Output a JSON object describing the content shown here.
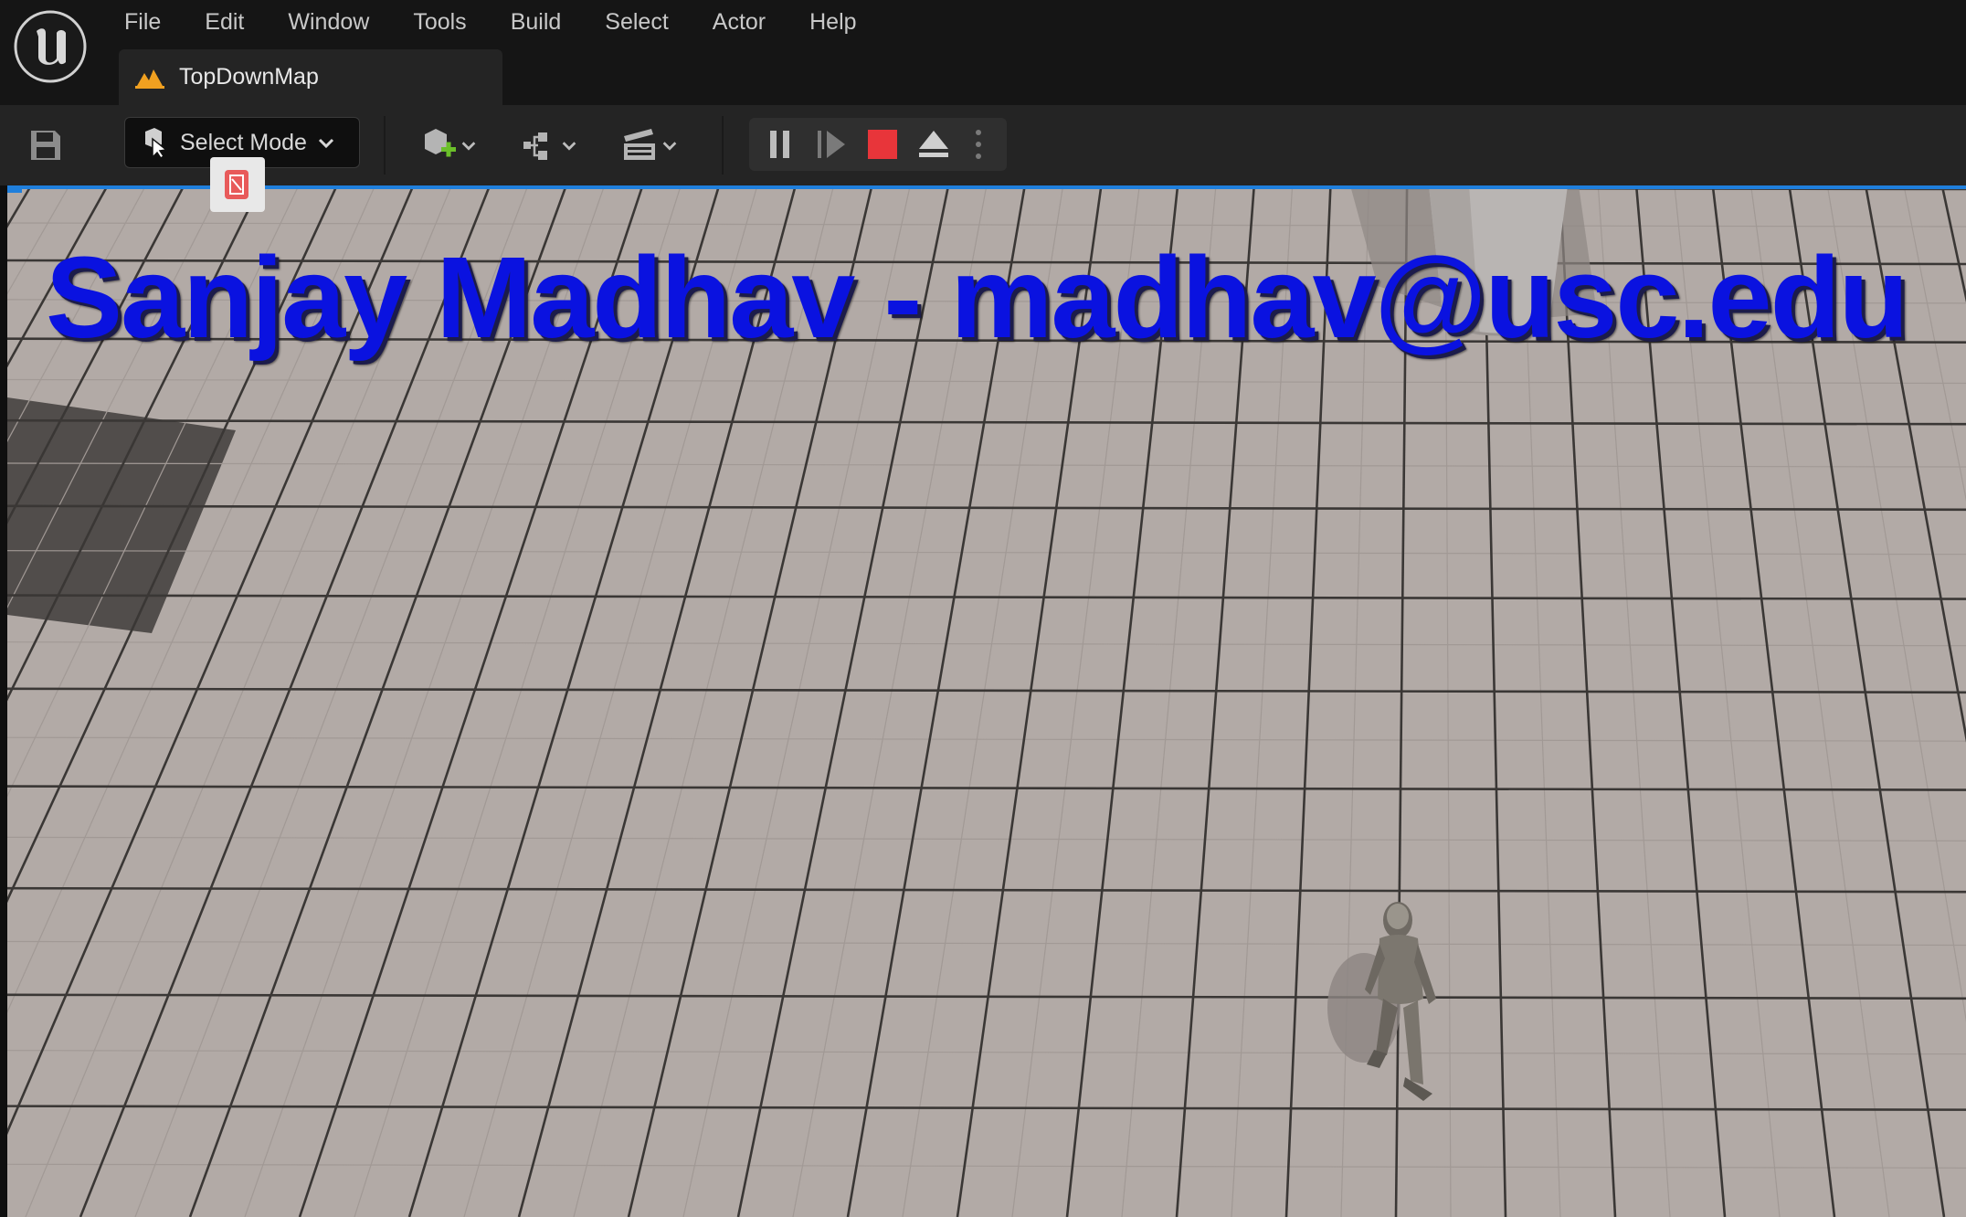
{
  "menu": {
    "items": [
      "File",
      "Edit",
      "Window",
      "Tools",
      "Build",
      "Select",
      "Actor",
      "Help"
    ]
  },
  "tab": {
    "label": "TopDownMap",
    "icon": "level-map-icon"
  },
  "toolbar": {
    "save_icon": "save-icon",
    "select_mode_label": "Select Mode",
    "add_actor_icon": "add-actor-icon",
    "blueprint_icon": "blueprint-icon",
    "cinematics_icon": "clapperboard-icon",
    "pause_icon": "pause-icon",
    "step_icon": "frame-advance-icon",
    "stop_icon": "stop-icon",
    "eject_icon": "eject-icon",
    "more_icon": "more-options-icon"
  },
  "viewport": {
    "overlay_text": "Sanjay Madhav - madhav@usc.edu",
    "overlay_color": "#0a12e0",
    "floor_color": "#b2aaa6",
    "grid_line_color": "#3a3735"
  },
  "colors": {
    "accent_blue": "#1f7fdc",
    "stop_red": "#e8353a",
    "add_green": "#6bbf2a",
    "warning_orange": "#f0a020"
  }
}
